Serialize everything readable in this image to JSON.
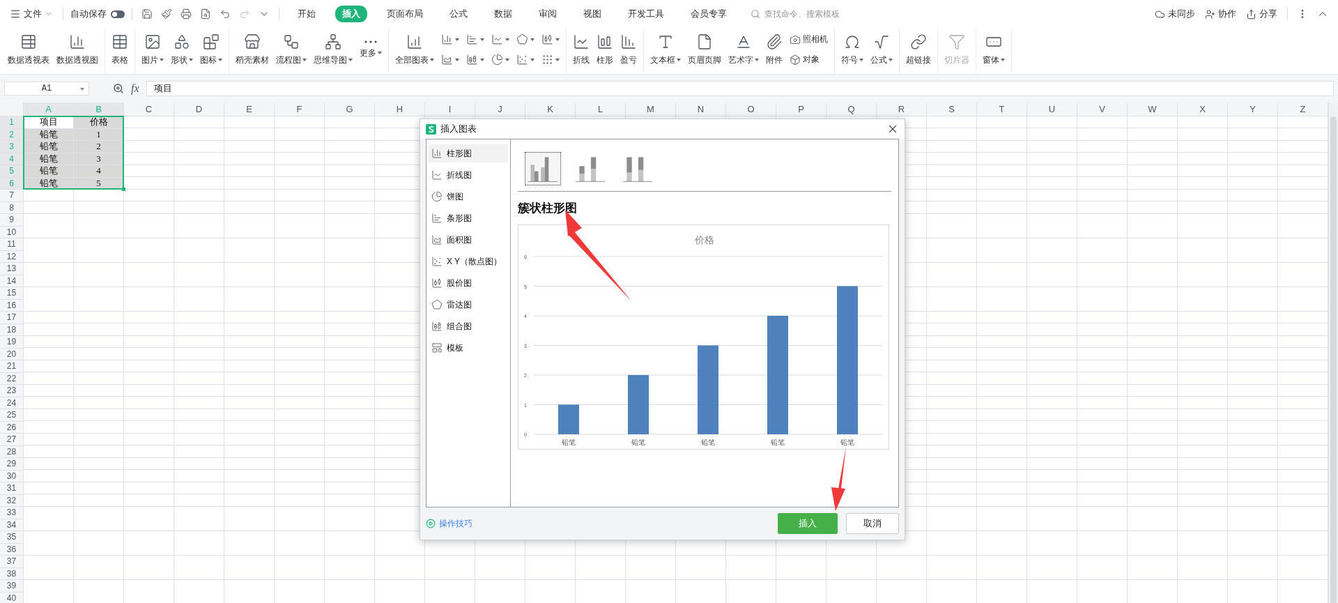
{
  "menu_bar": {
    "file_menu": "文件",
    "autosave": {
      "label": "自动保存",
      "on": false
    },
    "tabs": [
      {
        "label": "开始",
        "selected": false
      },
      {
        "label": "插入",
        "selected": true
      },
      {
        "label": "页面布局",
        "selected": false
      },
      {
        "label": "公式",
        "selected": false
      },
      {
        "label": "数据",
        "selected": false
      },
      {
        "label": "审阅",
        "selected": false
      },
      {
        "label": "视图",
        "selected": false
      },
      {
        "label": "开发工具",
        "selected": false
      },
      {
        "label": "会员专享",
        "selected": false
      }
    ],
    "search": {
      "placeholder": "查找命令、搜索模板"
    },
    "actions": [
      "未同步",
      "协作",
      "分享"
    ]
  },
  "ribbon": {
    "groups": [
      {
        "items": [
          {
            "kind": "large",
            "label": "数据透视表",
            "caret": false,
            "disabled": false
          },
          {
            "kind": "large",
            "label": "数据透视图",
            "caret": false,
            "disabled": false
          }
        ]
      },
      {
        "items": [
          {
            "kind": "large",
            "label": "表格",
            "caret": false,
            "disabled": false
          }
        ]
      },
      {
        "items": [
          {
            "kind": "large",
            "label": "图片",
            "caret": true,
            "disabled": false
          },
          {
            "kind": "large",
            "label": "形状",
            "caret": true,
            "disabled": false
          },
          {
            "kind": "large",
            "label": "图标",
            "caret": true,
            "disabled": false
          }
        ]
      },
      {
        "items": [
          {
            "kind": "large",
            "label": "稻壳素材",
            "caret": false,
            "disabled": false
          },
          {
            "kind": "large",
            "label": "流程图",
            "caret": true,
            "disabled": false
          },
          {
            "kind": "large",
            "label": "思维导图",
            "caret": true,
            "disabled": false
          },
          {
            "kind": "large",
            "label": "更多",
            "caret": true,
            "disabled": false
          }
        ]
      },
      {
        "items": [
          {
            "kind": "large",
            "label": "全部图表",
            "caret": true,
            "disabled": false
          },
          {
            "kind": "mini",
            "caret": true,
            "disabled": false
          },
          {
            "kind": "mini",
            "caret": true,
            "disabled": false
          },
          {
            "kind": "mini",
            "caret": true,
            "disabled": false
          },
          {
            "kind": "mini",
            "caret": true,
            "disabled": false
          },
          {
            "kind": "mini",
            "caret": true,
            "disabled": false
          },
          {
            "kind": "mini",
            "caret": true,
            "disabled": false
          },
          {
            "kind": "mini",
            "caret": true,
            "disabled": false
          },
          {
            "kind": "mini",
            "caret": true,
            "disabled": false
          },
          {
            "kind": "mini",
            "caret": true,
            "disabled": false
          },
          {
            "kind": "mini",
            "caret": true,
            "disabled": false
          }
        ]
      },
      {
        "items": [
          {
            "kind": "large",
            "label": "折线",
            "caret": false,
            "disabled": false
          },
          {
            "kind": "large",
            "label": "柱形",
            "caret": false,
            "disabled": false
          },
          {
            "kind": "large",
            "label": "盈亏",
            "caret": false,
            "disabled": false
          }
        ]
      },
      {
        "items": [
          {
            "kind": "large",
            "label": "文本框",
            "caret": true,
            "disabled": false
          },
          {
            "kind": "large",
            "label": "页眉页脚",
            "caret": false,
            "disabled": false
          },
          {
            "kind": "large",
            "label": "艺术字",
            "caret": true,
            "disabled": false
          },
          {
            "kind": "large",
            "label": "附件",
            "caret": false,
            "disabled": false
          },
          {
            "kind": "small",
            "label": "照相机",
            "caret": false,
            "disabled": false
          },
          {
            "kind": "small",
            "label": "对象",
            "caret": false,
            "disabled": false
          }
        ]
      },
      {
        "items": [
          {
            "kind": "large",
            "label": "符号",
            "caret": true,
            "disabled": false
          },
          {
            "kind": "large",
            "label": "公式",
            "caret": true,
            "disabled": false
          }
        ]
      },
      {
        "items": [
          {
            "kind": "large",
            "label": "超链接",
            "caret": false,
            "disabled": false
          }
        ]
      },
      {
        "items": [
          {
            "kind": "large",
            "label": "切片器",
            "caret": false,
            "disabled": true
          }
        ]
      },
      {
        "items": [
          {
            "kind": "large",
            "label": "窗体",
            "caret": true,
            "disabled": false
          }
        ]
      }
    ]
  },
  "formula_bar": {
    "name_box": "A1",
    "function_label": "fx",
    "value": "项目"
  },
  "sheet": {
    "columns": [
      {
        "label": "A",
        "selected": true
      },
      {
        "label": "B",
        "selected": true
      },
      {
        "label": "C",
        "selected": false
      },
      {
        "label": "D",
        "selected": false
      },
      {
        "label": "E",
        "selected": false
      },
      {
        "label": "F",
        "selected": false
      },
      {
        "label": "G",
        "selected": false
      },
      {
        "label": "H",
        "selected": false
      },
      {
        "label": "I",
        "selected": false
      },
      {
        "label": "J",
        "selected": false
      },
      {
        "label": "K",
        "selected": false
      },
      {
        "label": "L",
        "selected": false
      },
      {
        "label": "M",
        "selected": false
      },
      {
        "label": "N",
        "selected": false
      },
      {
        "label": "O",
        "selected": false
      },
      {
        "label": "P",
        "selected": false
      },
      {
        "label": "Q",
        "selected": false
      },
      {
        "label": "R",
        "selected": false
      },
      {
        "label": "S",
        "selected": false
      },
      {
        "label": "T",
        "selected": false
      },
      {
        "label": "U",
        "selected": false
      },
      {
        "label": "V",
        "selected": false
      },
      {
        "label": "W",
        "selected": false
      },
      {
        "label": "X",
        "selected": false
      },
      {
        "label": "Y",
        "selected": false
      },
      {
        "label": "Z",
        "selected": false
      }
    ],
    "rows": [
      {
        "label": "1",
        "selected": true,
        "cells": [
          {
            "text": "项目",
            "active": true
          },
          {
            "text": "价格",
            "active": false
          }
        ]
      },
      {
        "label": "2",
        "selected": true,
        "cells": [
          {
            "text": "铅笔",
            "active": false
          },
          {
            "text": "1",
            "active": false
          }
        ]
      },
      {
        "label": "3",
        "selected": true,
        "cells": [
          {
            "text": "铅笔",
            "active": false
          },
          {
            "text": "2",
            "active": false
          }
        ]
      },
      {
        "label": "4",
        "selected": true,
        "cells": [
          {
            "text": "铅笔",
            "active": false
          },
          {
            "text": "3",
            "active": false
          }
        ]
      },
      {
        "label": "5",
        "selected": true,
        "cells": [
          {
            "text": "铅笔",
            "active": false
          },
          {
            "text": "4",
            "active": false
          }
        ]
      },
      {
        "label": "6",
        "selected": true,
        "cells": [
          {
            "text": "铅笔",
            "active": false
          },
          {
            "text": "5",
            "active": false
          }
        ]
      },
      {
        "label": "7",
        "selected": false
      },
      {
        "label": "8",
        "selected": false
      },
      {
        "label": "9",
        "selected": false
      },
      {
        "label": "10",
        "selected": false
      },
      {
        "label": "11",
        "selected": false
      },
      {
        "label": "12",
        "selected": false
      },
      {
        "label": "13",
        "selected": false
      },
      {
        "label": "14",
        "selected": false
      },
      {
        "label": "15",
        "selected": false
      },
      {
        "label": "16",
        "selected": false
      },
      {
        "label": "17",
        "selected": false
      },
      {
        "label": "18",
        "selected": false
      },
      {
        "label": "19",
        "selected": false
      },
      {
        "label": "20",
        "selected": false
      },
      {
        "label": "21",
        "selected": false
      },
      {
        "label": "22",
        "selected": false
      },
      {
        "label": "23",
        "selected": false
      },
      {
        "label": "24",
        "selected": false
      },
      {
        "label": "25",
        "selected": false
      },
      {
        "label": "26",
        "selected": false
      },
      {
        "label": "27",
        "selected": false
      },
      {
        "label": "28",
        "selected": false
      },
      {
        "label": "29",
        "selected": false
      },
      {
        "label": "30",
        "selected": false
      },
      {
        "label": "31",
        "selected": false
      },
      {
        "label": "32",
        "selected": false
      },
      {
        "label": "33",
        "selected": false
      },
      {
        "label": "34",
        "selected": false
      },
      {
        "label": "35",
        "selected": false
      },
      {
        "label": "36",
        "selected": false
      },
      {
        "label": "37",
        "selected": false
      },
      {
        "label": "38",
        "selected": false
      },
      {
        "label": "39",
        "selected": false
      },
      {
        "label": "40",
        "selected": false
      }
    ]
  },
  "dialog": {
    "title": "插入图表",
    "chart_types": [
      {
        "label": "柱形图",
        "selected": true
      },
      {
        "label": "折线图",
        "selected": false
      },
      {
        "label": "饼图",
        "selected": false
      },
      {
        "label": "条形图",
        "selected": false
      },
      {
        "label": "面积图",
        "selected": false
      },
      {
        "label": "X Y（散点图）",
        "selected": false
      },
      {
        "label": "股价图",
        "selected": false
      },
      {
        "label": "雷达图",
        "selected": false
      },
      {
        "label": "组合图",
        "selected": false
      },
      {
        "label": "模板",
        "selected": false
      }
    ],
    "subtypes": [
      {
        "kind": "clustered",
        "selected": true
      },
      {
        "kind": "stacked",
        "selected": false
      },
      {
        "kind": "percent",
        "selected": false
      }
    ],
    "subtype_title": "簇状柱形图",
    "preview": {
      "chart_data": {
        "type": "bar",
        "title": "价格",
        "categories": [
          "铅笔",
          "铅笔",
          "铅笔",
          "铅笔",
          "铅笔"
        ],
        "series": [
          {
            "color": "#4f81bd",
            "values": [
              1,
              2,
              3,
              4,
              5
            ]
          }
        ],
        "grid": true,
        "ylim": [
          0,
          6
        ],
        "yticks": [
          0,
          1,
          2,
          3,
          4,
          5,
          6
        ]
      }
    },
    "tips_link": "操作技巧",
    "buttons": [
      {
        "label": "插入",
        "kind": "primary"
      },
      {
        "label": "取消",
        "kind": "secondary"
      }
    ]
  }
}
